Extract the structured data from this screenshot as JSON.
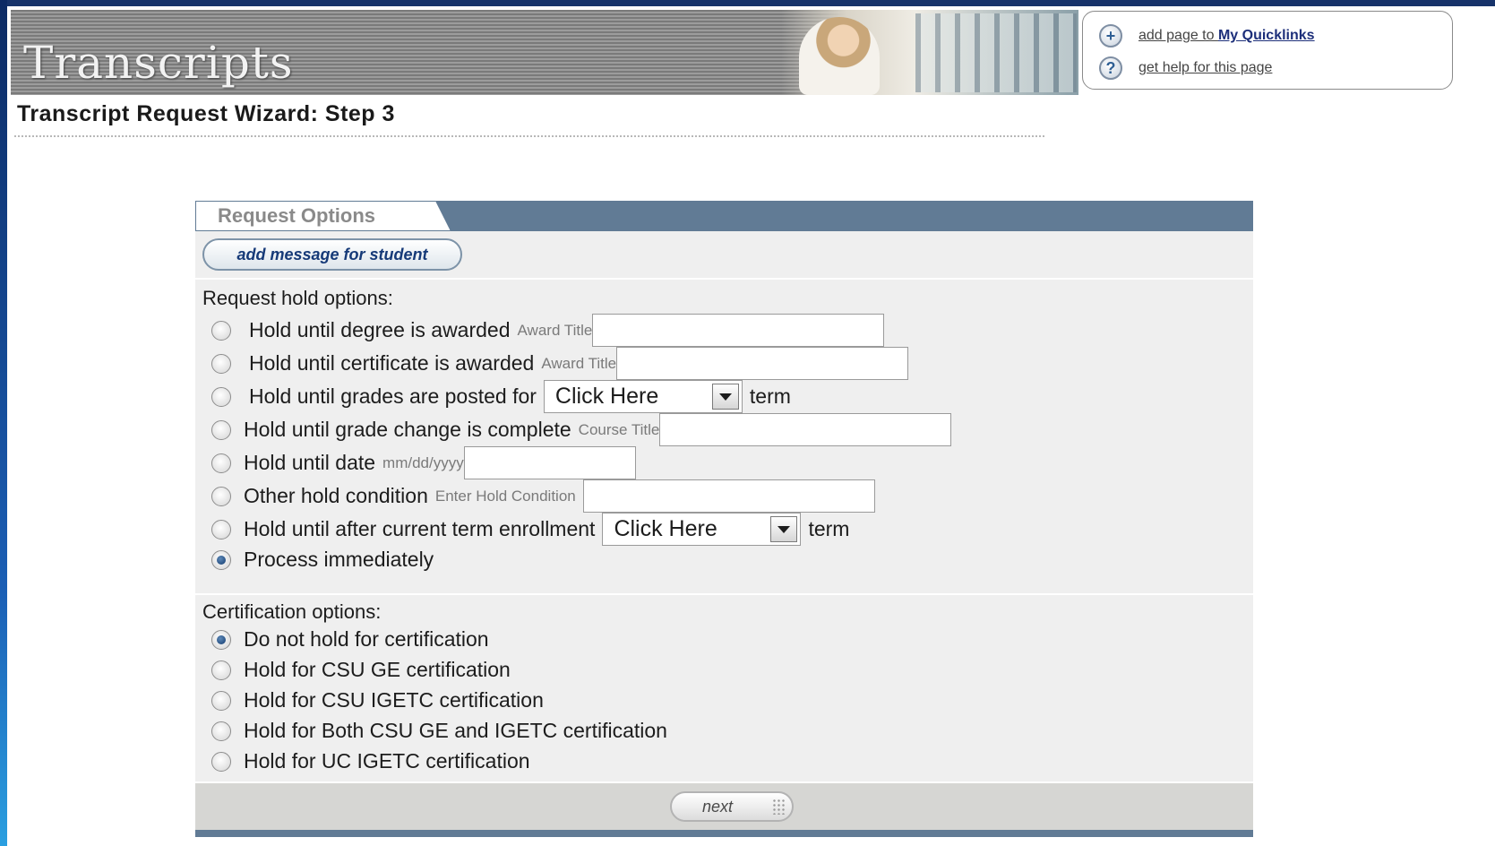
{
  "header": {
    "banner_title": "Transcripts",
    "quicklinks": {
      "add_prefix": "add page to ",
      "add_link": "My Quicklinks",
      "help": "get help for this page"
    }
  },
  "page_title": "Transcript Request Wizard: Step 3",
  "panel": {
    "tab_label": "Request Options",
    "message_button": "add message for student",
    "hold_section": {
      "label": "Request hold options:",
      "options": [
        {
          "label": "Hold until degree is awarded",
          "hint": "Award Title",
          "field": "text",
          "checked": false
        },
        {
          "label": "Hold until certificate is awarded",
          "hint": "Award Title",
          "field": "text",
          "checked": false
        },
        {
          "label": "Hold until grades are posted for",
          "select": "Click Here",
          "suffix": "term",
          "checked": false
        },
        {
          "label": "Hold until grade change is complete",
          "hint": "Course Title",
          "field": "text",
          "checked": false
        },
        {
          "label": "Hold until date",
          "hint": "mm/dd/yyyy",
          "field": "text",
          "checked": false
        },
        {
          "label": "Other hold condition",
          "hint": "Enter Hold Condition",
          "field": "text",
          "checked": false
        },
        {
          "label": "Hold until after current term enrollment",
          "select": "Click Here",
          "suffix": "term",
          "checked": false
        },
        {
          "label": "Process immediately",
          "checked": true
        }
      ]
    },
    "cert_section": {
      "label": "Certification options:",
      "options": [
        {
          "label": "Do not hold for certification",
          "checked": true
        },
        {
          "label": "Hold for CSU GE certification",
          "checked": false
        },
        {
          "label": "Hold for CSU IGETC certification",
          "checked": false
        },
        {
          "label": "Hold for Both CSU GE and IGETC certification",
          "checked": false
        },
        {
          "label": "Hold for UC IGETC certification",
          "checked": false
        }
      ]
    },
    "next_button": "next"
  },
  "colors": {
    "accent_bar": "#617b95",
    "panel_bg": "#efefef",
    "link": "#1d2f7a"
  }
}
